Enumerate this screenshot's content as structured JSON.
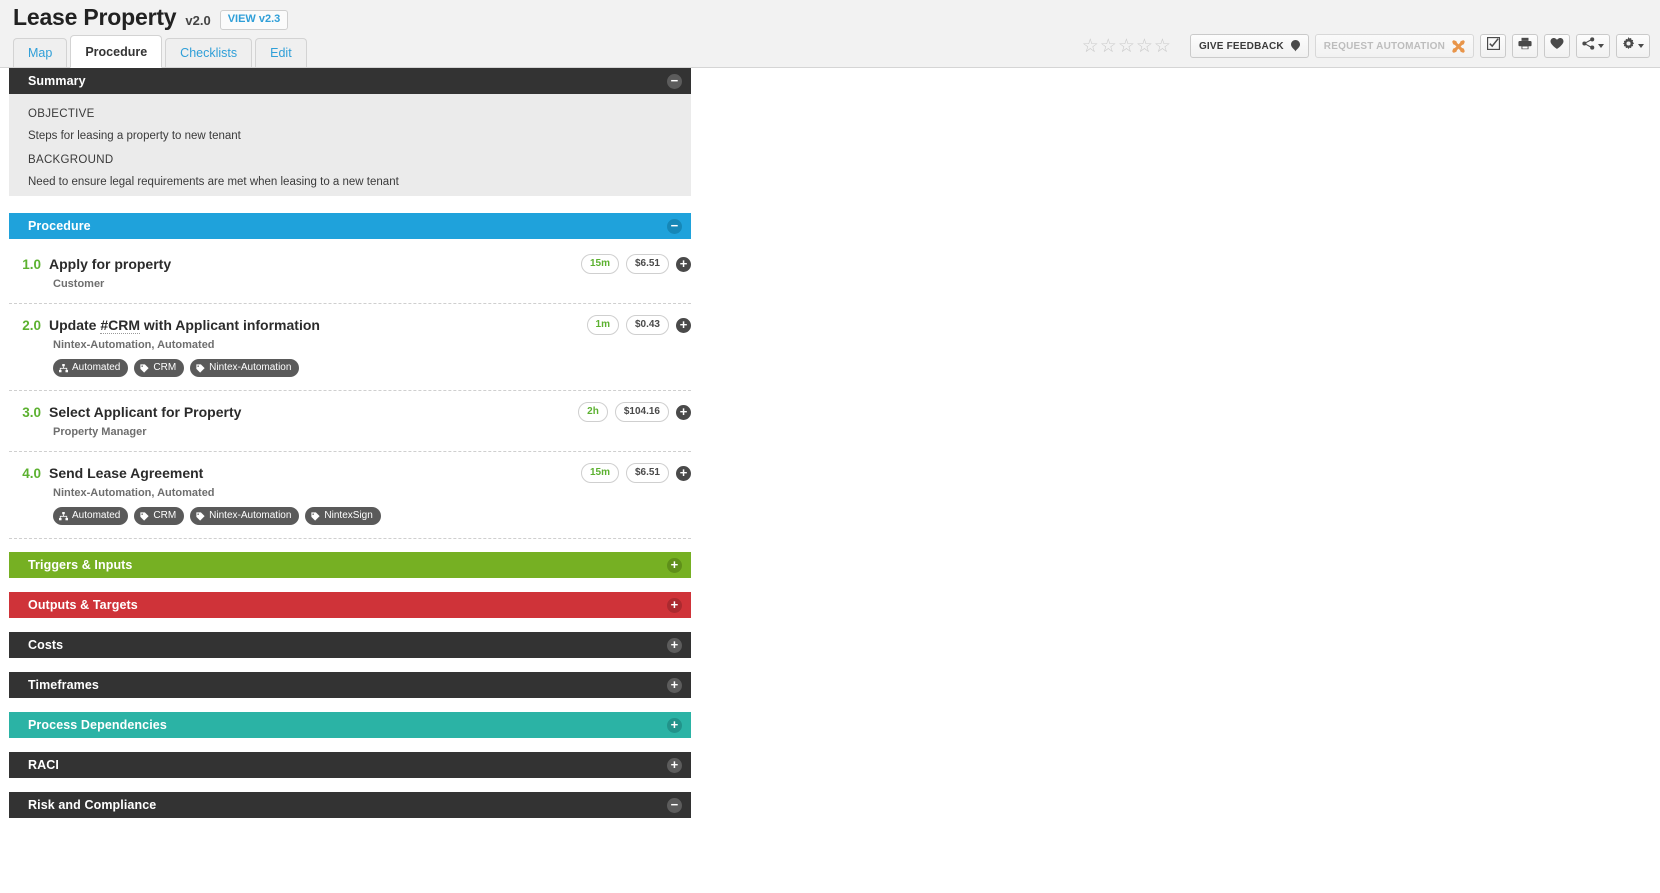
{
  "header": {
    "title": "Lease Property",
    "version": "v2.0",
    "view_version_label": "VIEW v2.3",
    "tabs": [
      {
        "label": "Map",
        "active": false
      },
      {
        "label": "Procedure",
        "active": true
      },
      {
        "label": "Checklists",
        "active": false
      },
      {
        "label": "Edit",
        "active": false
      }
    ],
    "rating": {
      "stars_total": 5,
      "stars_filled": 0,
      "glyph": "☆"
    },
    "toolbar": {
      "give_feedback_label": "GIVE FEEDBACK",
      "request_automation_label": "REQUEST AUTOMATION",
      "request_automation_disabled": true,
      "icons": [
        "checkbox-task-icon",
        "print-icon",
        "favorite-heart-icon",
        "share-icon",
        "settings-gear-icon"
      ]
    }
  },
  "summary": {
    "section_title": "Summary",
    "collapse_glyph": "−",
    "objective_label": "OBJECTIVE",
    "objective_text": "Steps for leasing a property to new tenant",
    "background_label": "BACKGROUND",
    "background_text": "Need to ensure legal requirements are met when leasing to a new tenant"
  },
  "procedure": {
    "section_title": "Procedure",
    "collapse_glyph": "−",
    "expand_glyph": "+",
    "steps": [
      {
        "number": "1.0",
        "title": "Apply for property",
        "title_pre": "Apply for property",
        "title_ref": "",
        "title_post": "",
        "role": "Customer",
        "time": "15m",
        "cost": "$6.51",
        "tags": []
      },
      {
        "number": "2.0",
        "title": "Update #CRM with Applicant information",
        "title_pre": "Update ",
        "title_ref": "#CRM",
        "title_post": " with Applicant information",
        "role": "Nintex-Automation, Automated",
        "time": "1m",
        "cost": "$0.43",
        "tags": [
          {
            "label": "Automated",
            "icon": "sitemap-icon"
          },
          {
            "label": "CRM",
            "icon": "tag-icon"
          },
          {
            "label": "Nintex-Automation",
            "icon": "tag-icon"
          }
        ]
      },
      {
        "number": "3.0",
        "title": "Select Applicant for Property",
        "title_pre": "Select Applicant for Property",
        "title_ref": "",
        "title_post": "",
        "role": "Property Manager",
        "time": "2h",
        "cost": "$104.16",
        "tags": []
      },
      {
        "number": "4.0",
        "title": "Send Lease Agreement",
        "title_pre": "Send Lease Agreement",
        "title_ref": "",
        "title_post": "",
        "role": "Nintex-Automation, Automated",
        "time": "15m",
        "cost": "$6.51",
        "tags": [
          {
            "label": "Automated",
            "icon": "sitemap-icon"
          },
          {
            "label": "CRM",
            "icon": "tag-icon"
          },
          {
            "label": "Nintex-Automation",
            "icon": "tag-icon"
          },
          {
            "label": "NintexSign",
            "icon": "tag-icon"
          }
        ]
      }
    ]
  },
  "sections": [
    {
      "title": "Triggers & Inputs",
      "color_class": "sec-green",
      "state_glyph": "+",
      "collapsed": true
    },
    {
      "title": "Outputs & Targets",
      "color_class": "sec-red",
      "state_glyph": "+",
      "collapsed": true
    },
    {
      "title": "Costs",
      "color_class": "sec-dark",
      "state_glyph": "+",
      "collapsed": true
    },
    {
      "title": "Timeframes",
      "color_class": "sec-dark",
      "state_glyph": "+",
      "collapsed": true
    },
    {
      "title": "Process Dependencies",
      "color_class": "sec-teal",
      "state_glyph": "+",
      "collapsed": true
    },
    {
      "title": "RACI",
      "color_class": "sec-dark",
      "state_glyph": "+",
      "collapsed": true
    },
    {
      "title": "Risk and Compliance",
      "color_class": "sec-dark",
      "state_glyph": "−",
      "collapsed": false
    }
  ],
  "colors": {
    "accent_blue": "#1fa2db",
    "green": "#76b023",
    "red": "#cf3339",
    "teal": "#2bb3a5",
    "dark": "#333333",
    "step_number_green": "#5cb130",
    "link_blue": "#2f9fd8"
  }
}
